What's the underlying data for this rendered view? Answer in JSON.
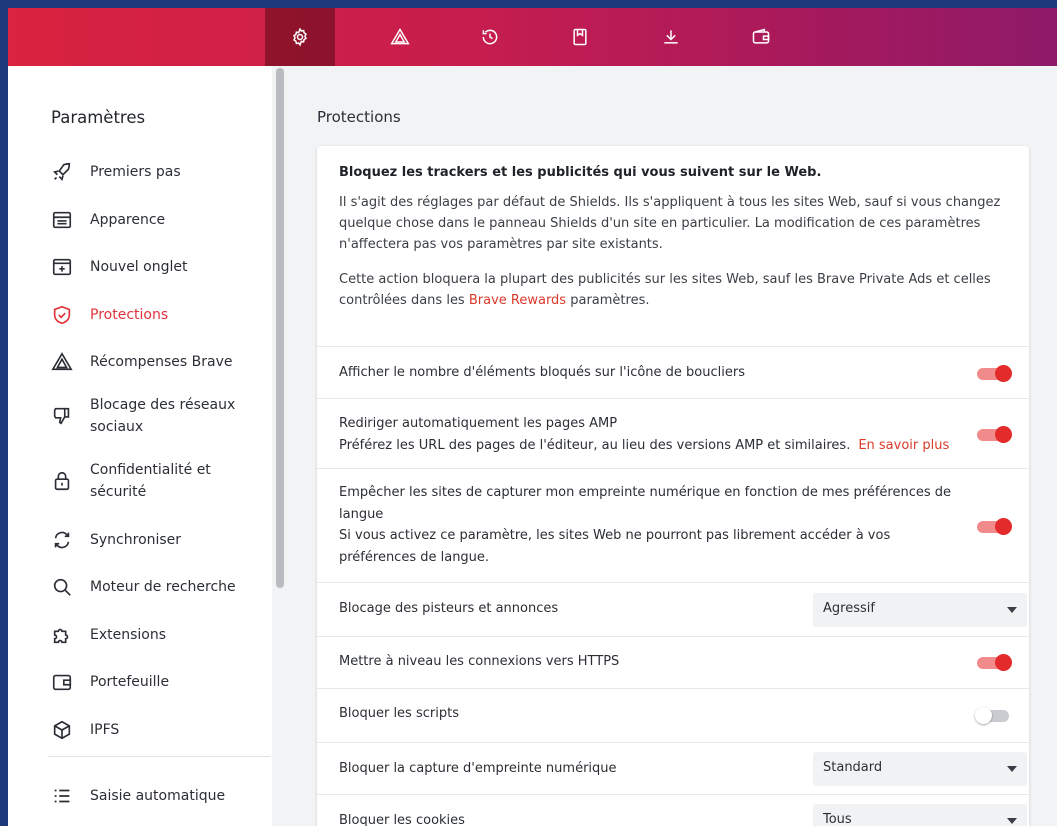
{
  "sidebar": {
    "title": "Paramètres",
    "items": [
      {
        "label": "Premiers pas",
        "icon": "rocket-icon"
      },
      {
        "label": "Apparence",
        "icon": "appearance-icon"
      },
      {
        "label": "Nouvel onglet",
        "icon": "new-tab-icon"
      },
      {
        "label": "Protections",
        "icon": "shield-icon"
      },
      {
        "label": "Récompenses Brave",
        "icon": "rewards-triangle-icon"
      },
      {
        "label": "Blocage des réseaux sociaux",
        "icon": "thumbs-down-icon"
      },
      {
        "label": "Confidentialité et sécurité",
        "icon": "lock-icon"
      },
      {
        "label": "Synchroniser",
        "icon": "sync-icon"
      },
      {
        "label": "Moteur de recherche",
        "icon": "search-icon"
      },
      {
        "label": "Extensions",
        "icon": "puzzle-icon"
      },
      {
        "label": "Portefeuille",
        "icon": "wallet-icon"
      },
      {
        "label": "IPFS",
        "icon": "cube-icon"
      },
      {
        "label": "Saisie automatique",
        "icon": "list-icon"
      }
    ],
    "active": "Protections"
  },
  "topbar": {
    "tabs": [
      "settings-gear-icon",
      "rewards-triangle-icon",
      "history-icon",
      "bookmarks-icon",
      "download-icon",
      "wallet-icon"
    ],
    "active_tab": "settings-gear-icon"
  },
  "main": {
    "title": "Protections",
    "intro": {
      "heading": "Bloquez les trackers et les publicités qui vous suivent sur le Web.",
      "p1": "Il s'agit des réglages par défaut de Shields. Ils s'appliquent à tous les sites Web, sauf si vous changez quelque chose dans le panneau Shields d'un site en particulier. La modification de ces paramètres n'affectera pas vos paramètres par site existants.",
      "p2_before": "Cette action bloquera la plupart des publicités sur les sites Web, sauf les Brave Private Ads et celles contrôlées dans les ",
      "p2_link": "Brave Rewards",
      "p2_after": " paramètres."
    },
    "settings": [
      {
        "label": "Afficher le nombre d'éléments bloqués sur l'icône de boucliers",
        "type": "toggle",
        "on": true
      },
      {
        "label": "Rediriger automatiquement les pages AMP",
        "sub": "Préférez les URL des pages de l'éditeur, au lieu des versions AMP et similaires.",
        "link": "En savoir plus",
        "type": "toggle",
        "on": true
      },
      {
        "label": "Empêcher les sites de capturer mon empreinte numérique en fonction de mes préférences de langue",
        "sub": "Si vous activez ce paramètre, les sites Web ne pourront pas librement accéder à vos préférences de langue.",
        "type": "toggle",
        "on": true
      },
      {
        "label": "Blocage des pisteurs et annonces",
        "type": "select",
        "value": "Agressif"
      },
      {
        "label": "Mettre à niveau les connexions vers HTTPS",
        "type": "toggle",
        "on": true
      },
      {
        "label": "Bloquer les scripts",
        "type": "toggle",
        "on": false
      },
      {
        "label": "Bloquer la capture d'empreinte numérique",
        "type": "select",
        "value": "Standard"
      },
      {
        "label": "Bloquer les cookies",
        "type": "select",
        "value": "Tous"
      }
    ]
  },
  "colors": {
    "accent": "#e32b2b",
    "link": "#d93a2a",
    "topbar_start": "#d9233f",
    "topbar_end": "#8e1a68"
  }
}
